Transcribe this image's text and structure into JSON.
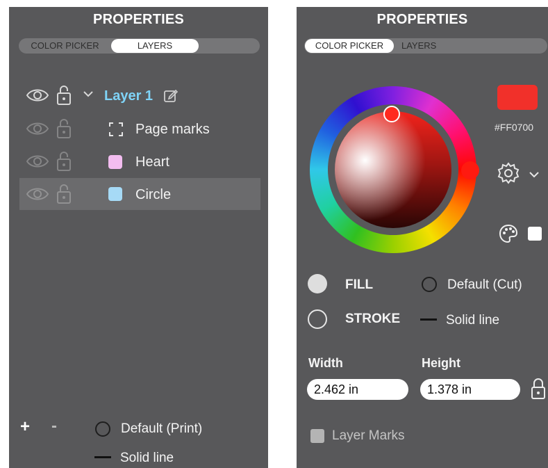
{
  "left_panel": {
    "title": "PROPERTIES",
    "tabs": [
      {
        "label": "COLOR PICKER",
        "active": false
      },
      {
        "label": "LAYERS",
        "active": true
      }
    ],
    "parent_layer": {
      "name": "Layer 1",
      "color": "#7fd3f7"
    },
    "layers": [
      {
        "name": "Page marks",
        "icon": "page-marks-icon"
      },
      {
        "name": "Heart",
        "swatch": "#f3bdf0"
      },
      {
        "name": "Circle",
        "swatch": "#a6daf6",
        "selected": true
      }
    ],
    "footer": {
      "add": "+",
      "remove": "-",
      "fill_label": "Default (Print)",
      "stroke_label": "Solid line"
    }
  },
  "right_panel": {
    "title": "PROPERTIES",
    "tabs": [
      {
        "label": "COLOR PICKER",
        "active": true
      },
      {
        "label": "LAYERS",
        "active": false
      }
    ],
    "color_hex": "#FF0700",
    "current_color": "#f1302a",
    "fill": {
      "label": "FILL",
      "value": "Default (Cut)"
    },
    "stroke": {
      "label": "STROKE",
      "value": "Solid line"
    },
    "width": {
      "label": "Width",
      "value": "2.462 in"
    },
    "height": {
      "label": "Height",
      "value": "1.378 in"
    },
    "layer_marks": "Layer Marks"
  }
}
